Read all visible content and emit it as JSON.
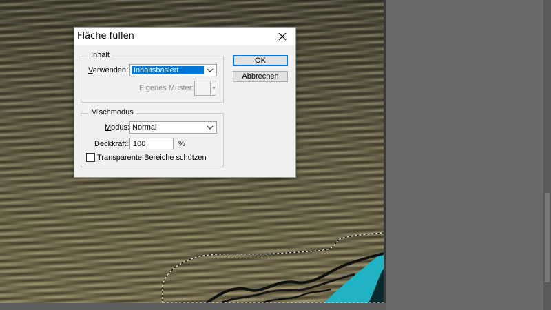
{
  "dialog": {
    "title": "Fläche füllen",
    "close_icon": "close-icon",
    "content_group": {
      "legend": "Inhalt",
      "use_label_access": "V",
      "use_label_rest": "erwenden:",
      "use_value": "Inhaltsbasiert",
      "custom_pattern_label": "Eigenes Muster:"
    },
    "blend_group": {
      "legend": "Mischmodus",
      "mode_label_access": "M",
      "mode_label_rest": "odus:",
      "mode_value": "Normal",
      "opacity_label_access": "D",
      "opacity_label_rest": "eckkraft:",
      "opacity_value": "100",
      "opacity_unit": "%",
      "preserve_label_access": "T",
      "preserve_label_rest": "ransparente Bereiche schützen",
      "preserve_checked": false
    },
    "buttons": {
      "ok": "OK",
      "cancel": "Abbrechen"
    }
  },
  "colors": {
    "accent": "#0078d7",
    "dialog_bg": "#f0f0f0",
    "workspace_bg": "#6b6b6b",
    "kayak_cyan": "#1fb3c4"
  }
}
